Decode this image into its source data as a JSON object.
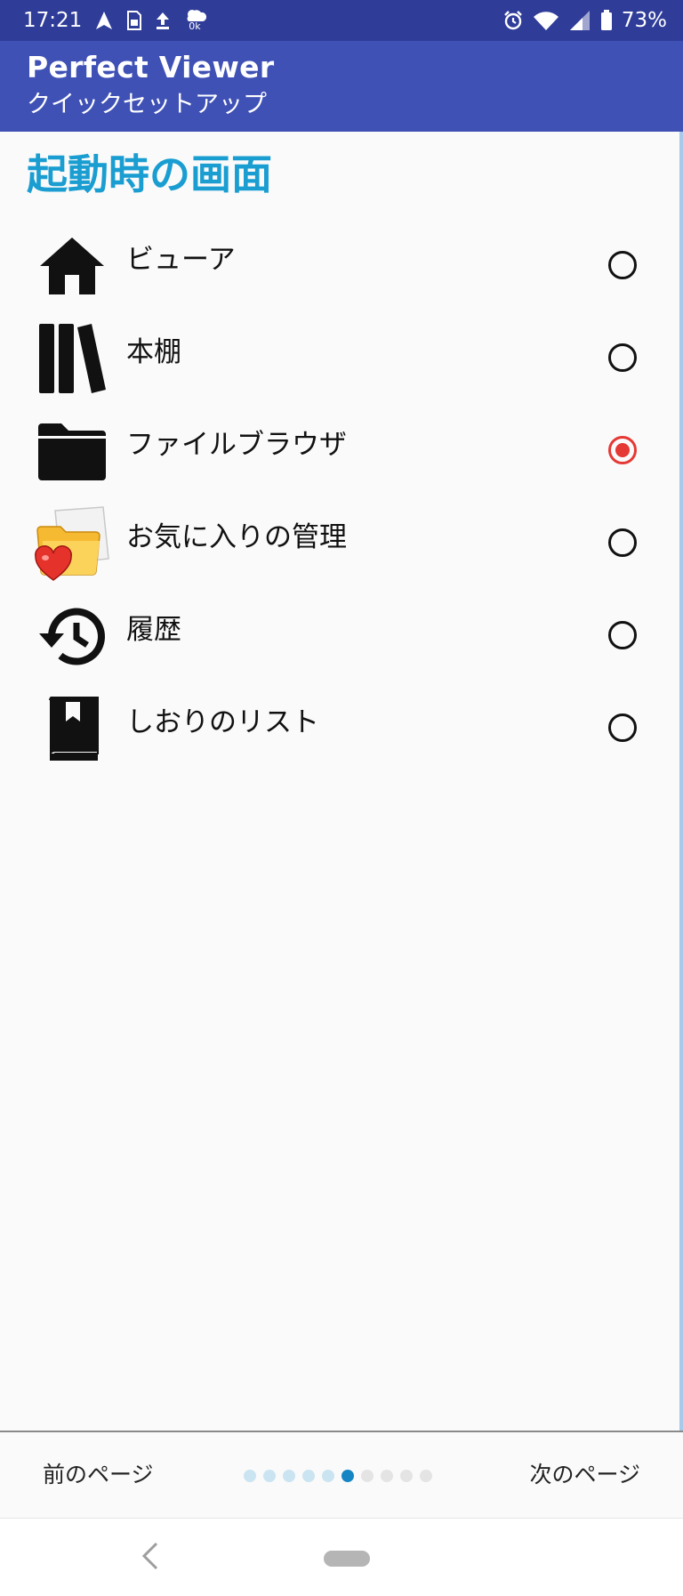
{
  "status_bar": {
    "time": "17:21",
    "battery": "73%",
    "data_rate": "0k"
  },
  "app_bar": {
    "title": "Perfect Viewer",
    "subtitle": "クイックセットアップ"
  },
  "section_title": "起動時の画面",
  "options": [
    {
      "label": "ビューア",
      "icon": "home-icon",
      "selected": false
    },
    {
      "label": "本棚",
      "icon": "bookshelf-icon",
      "selected": false
    },
    {
      "label": "ファイルブラウザ",
      "icon": "folder-icon",
      "selected": true
    },
    {
      "label": "お気に入りの管理",
      "icon": "favorite-folder-icon",
      "selected": false
    },
    {
      "label": "履歴",
      "icon": "history-icon",
      "selected": false
    },
    {
      "label": "しおりのリスト",
      "icon": "bookmark-book-icon",
      "selected": false
    }
  ],
  "footer": {
    "prev_label": "前のページ",
    "next_label": "次のページ",
    "page_dots_total": 10,
    "page_dots_current": 6
  },
  "colors": {
    "status_bar": "#2f3d99",
    "app_bar": "#3f51b5",
    "section_title": "#1a9dd1",
    "radio_selected": "#e53935",
    "dot_active": "#1585c4"
  }
}
